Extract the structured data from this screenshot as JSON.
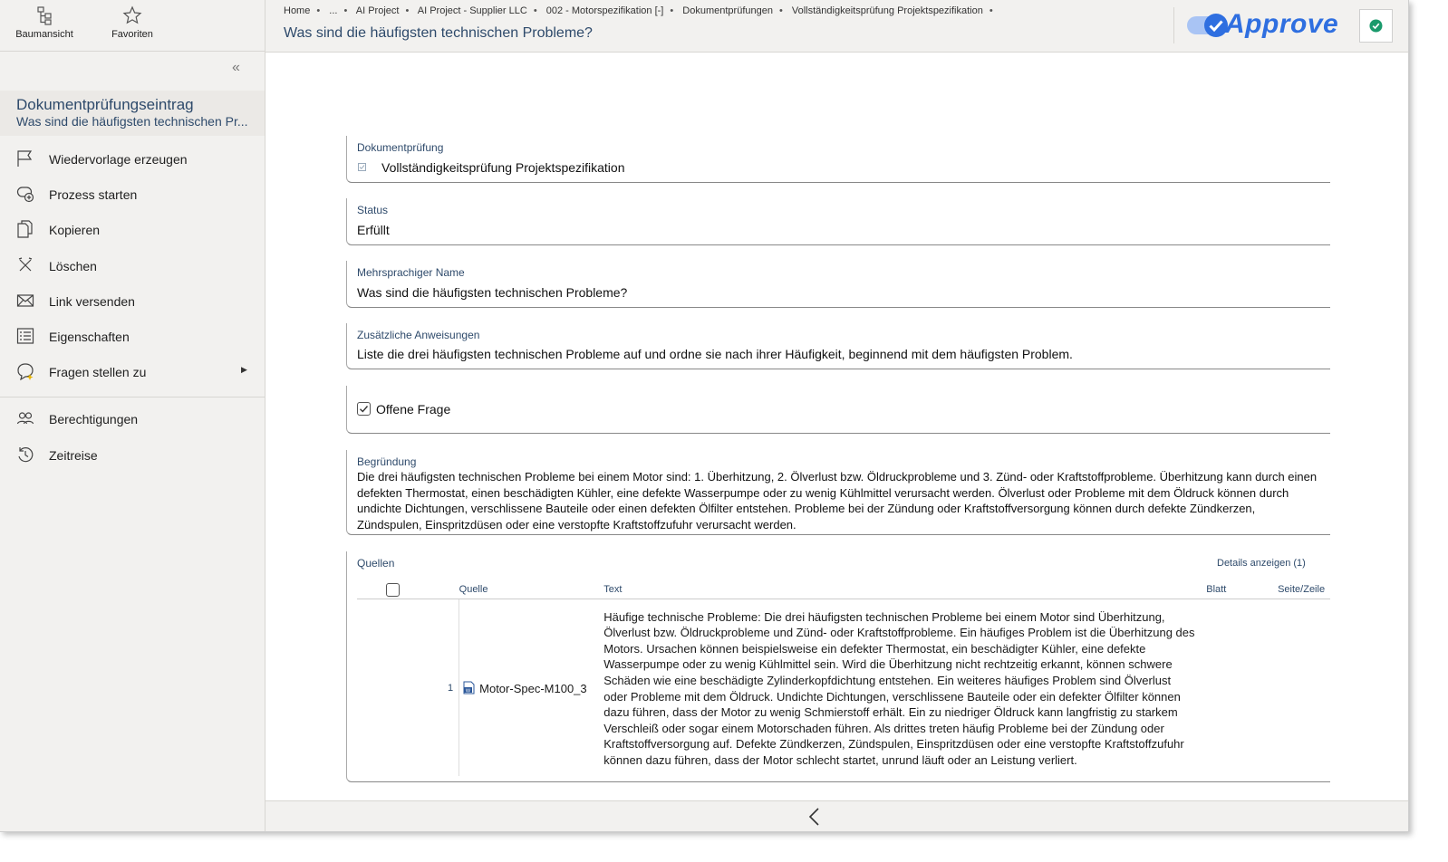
{
  "toolbar": {
    "tree_label": "Baumansicht",
    "favorites_label": "Favoriten"
  },
  "sidebar": {
    "collapse_glyph": "«",
    "entry_title": "Dokumentprüfungseintrag",
    "entry_subtitle": "Was sind die häufigsten technischen Pr...",
    "items": [
      {
        "label": "Wiedervorlage erzeugen"
      },
      {
        "label": "Prozess starten"
      },
      {
        "label": "Kopieren"
      },
      {
        "label": "Löschen"
      },
      {
        "label": "Link versenden"
      },
      {
        "label": "Eigenschaften"
      },
      {
        "label": "Fragen stellen zu"
      },
      {
        "label": "Berechtigungen"
      },
      {
        "label": "Zeitreise"
      }
    ]
  },
  "header": {
    "breadcrumb": [
      "Home",
      "...",
      "AI Project",
      "AI Project - Supplier LLC",
      "002 - Motorspezifikation [-]",
      "Dokumentprüfungen",
      "Vollständigkeitsprüfung Projektspezifikation"
    ],
    "title": "Was sind die häufigsten technischen Probleme?",
    "logo_text": "Approve"
  },
  "fields": {
    "review_label": "Dokumentprüfung",
    "review_value": "Vollständigkeitsprüfung Projektspezifikation",
    "status_label": "Status",
    "status_value": "Erfüllt",
    "name_label": "Mehrsprachiger Name",
    "name_value": "Was sind die häufigsten technischen Probleme?",
    "instructions_label": "Zusätzliche Anweisungen",
    "instructions_value": "Liste die drei häufigsten technischen Probleme auf und ordne sie nach ihrer Häufigkeit, beginnend mit dem häufigsten Problem.",
    "open_question_label": "Offene Frage",
    "reasoning_label": "Begründung",
    "reasoning_value": "Die drei häufigsten technischen Probleme bei einem Motor sind: 1. Überhitzung, 2. Ölverlust bzw. Öldruckprobleme und 3. Zünd- oder Kraftstoffprobleme. Überhitzung kann durch einen defekten Thermostat, einen beschädigten Kühler, eine defekte Wasserpumpe oder zu wenig Kühlmittel verursacht werden. Ölverlust oder Probleme mit dem Öldruck können durch undichte Dichtungen, verschlissene Bauteile oder einen defekten Ölfilter entstehen. Probleme bei der Zündung oder Kraftstoffversorgung können durch defekte Zündkerzen, Zündspulen, Einspritzdüsen oder eine verstopfte Kraftstoffzufuhr verursacht werden."
  },
  "sources": {
    "label": "Quellen",
    "details_link": "Details anzeigen (1)",
    "columns": {
      "source": "Quelle",
      "text": "Text",
      "sheet": "Blatt",
      "page_line": "Seite/Zeile"
    },
    "rows": [
      {
        "index": "1",
        "source": "Motor-Spec-M100_3",
        "text": "Häufige technische Probleme: Die drei häufigsten technischen Probleme bei einem Motor sind Überhitzung, Ölverlust bzw. Öldruckprobleme und Zünd- oder Kraftstoffprobleme. Ein häufiges Problem ist die Überhitzung des Motors. Ursachen können beispielsweise ein defekter Thermostat, ein beschädigter Kühler, eine defekte Wasserpumpe oder zu wenig Kühlmittel sein. Wird die Überhitzung nicht rechtzeitig erkannt, können schwere Schäden wie eine beschädigte Zylinderkopfdichtung entstehen. Ein weiteres häufiges Problem sind Ölverlust oder Probleme mit dem Öldruck. Undichte Dichtungen, verschlissene Bauteile oder ein defekter Ölfilter können dazu führen, dass der Motor zu wenig Schmierstoff erhält. Ein zu niedriger Öldruck kann langfristig zu starkem Verschleiß oder sogar einem Motorschaden führen. Als drittes treten häufig Probleme bei der Zündung oder Kraftstoffversorgung auf. Defekte Zündkerzen, Zündspulen, Einspritzdüsen oder eine verstopfte Kraftstoffzufuhr können dazu führen, dass der Motor schlecht startet, unrund läuft oder an Leistung verliert.",
        "sheet": "",
        "page_line": ""
      }
    ]
  },
  "colors": {
    "accent": "#2e4a6b",
    "brand": "#2f6fe0",
    "panel": "#f2f1ef",
    "ok": "#1a9a6c"
  }
}
